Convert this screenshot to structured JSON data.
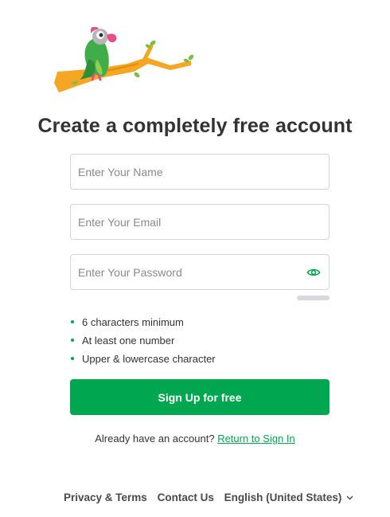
{
  "colors": {
    "accent": "#00a650",
    "text": "#333333",
    "border": "#d5d5d5"
  },
  "logo": {
    "icon": "parrot-on-branch-icon"
  },
  "page": {
    "title": "Create a completely free account"
  },
  "form": {
    "name_placeholder": "Enter Your Name",
    "name_value": "",
    "email_placeholder": "Enter Your Email",
    "email_value": "",
    "password_placeholder": "Enter Your Password",
    "password_value": "",
    "password_toggle_icon": "eye-icon"
  },
  "requirements": [
    "6 characters minimum",
    "At least one number",
    "Upper & lowercase character"
  ],
  "signup_button": "Sign Up for free",
  "signin": {
    "prompt": "Already have an account?",
    "link": "Return to Sign In"
  },
  "footer": {
    "privacy": "Privacy & Terms",
    "contact": "Contact Us",
    "language": "English (United States)",
    "language_icon": "chevron-down-icon"
  }
}
